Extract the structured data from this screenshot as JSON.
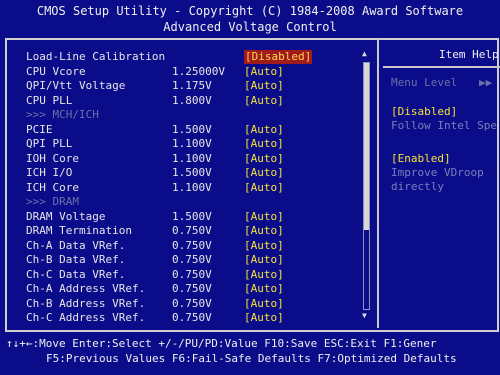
{
  "header": {
    "line1": "CMOS Setup Utility - Copyright (C) 1984-2008 Award Software",
    "line2": "Advanced Voltage Control"
  },
  "settings": [
    {
      "label": "Load-Line Calibration",
      "value": "",
      "option": "[Disabled]",
      "highlight": true
    },
    {
      "label": "CPU Vcore",
      "value": "1.25000V",
      "option": "[Auto]"
    },
    {
      "label": "QPI/Vtt Voltage",
      "value": "1.175V",
      "option": "[Auto]"
    },
    {
      "label": "CPU PLL",
      "value": "1.800V",
      "option": "[Auto]"
    },
    {
      "label": ">>> MCH/ICH",
      "value": "",
      "option": "",
      "dim": true
    },
    {
      "label": "PCIE",
      "value": "1.500V",
      "option": "[Auto]"
    },
    {
      "label": "QPI PLL",
      "value": "1.100V",
      "option": "[Auto]"
    },
    {
      "label": "IOH Core",
      "value": "1.100V",
      "option": "[Auto]"
    },
    {
      "label": "ICH I/O",
      "value": "1.500V",
      "option": "[Auto]"
    },
    {
      "label": "ICH Core",
      "value": "1.100V",
      "option": "[Auto]"
    },
    {
      "label": ">>> DRAM",
      "value": "",
      "option": "",
      "dim": true
    },
    {
      "label": "DRAM Voltage",
      "value": "1.500V",
      "option": "[Auto]"
    },
    {
      "label": "DRAM Termination",
      "value": "0.750V",
      "option": "[Auto]"
    },
    {
      "label": "Ch-A Data VRef.",
      "value": "0.750V",
      "option": "[Auto]"
    },
    {
      "label": "Ch-B Data VRef.",
      "value": "0.750V",
      "option": "[Auto]"
    },
    {
      "label": "Ch-C Data VRef.",
      "value": "0.750V",
      "option": "[Auto]"
    },
    {
      "label": "Ch-A Address VRef.",
      "value": "0.750V",
      "option": "[Auto]"
    },
    {
      "label": "Ch-B Address VRef.",
      "value": "0.750V",
      "option": "[Auto]"
    },
    {
      "label": "Ch-C Address VRef.",
      "value": "0.750V",
      "option": "[Auto]"
    }
  ],
  "scrollbar": {
    "position": 0.0,
    "visible_fraction": 0.68
  },
  "help": {
    "title": "Item Help",
    "menu_level": "Menu Level",
    "menu_arrows": "▶▶",
    "opt1": "[Disabled]",
    "opt1_desc": "Follow Intel Spe",
    "opt2": "[Enabled]",
    "opt2_desc1": "Improve VDroop",
    "opt2_desc2": "directly"
  },
  "footer": {
    "line1": "↑↓+←:Move  Enter:Select  +/-/PU/PD:Value  F10:Save  ESC:Exit  F1:Gener",
    "line2": "F5:Previous Values  F6:Fail-Safe Defaults  F7:Optimized Defaults"
  },
  "colors": {
    "background": "#0a0c8a",
    "option_text": "#f5e23a",
    "highlight_bg": "#a01b1b",
    "dim_text": "#6f6fa8"
  }
}
